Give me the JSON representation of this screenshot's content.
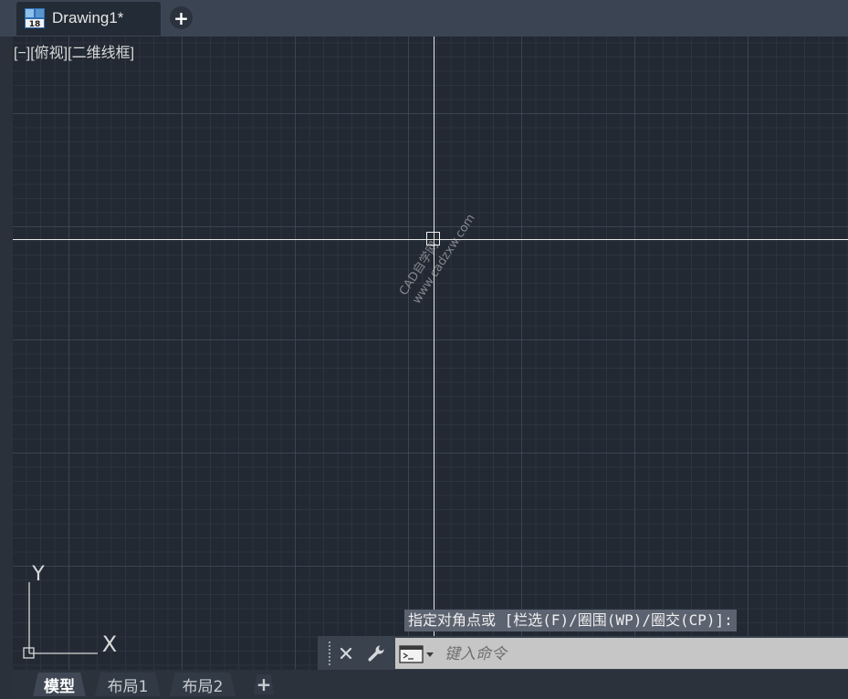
{
  "document_tab": {
    "title": "Drawing1*",
    "icon": "autocad-18-icon"
  },
  "new_tab": {
    "label": "+"
  },
  "viewport": {
    "view_label": "[−][俯视][二维线框]"
  },
  "watermark": {
    "line1": "CAD自学网",
    "line2": "www.cadzxw.com"
  },
  "ucs": {
    "y_label": "Y",
    "x_label": "X"
  },
  "command": {
    "prompt": "指定对角点或 [栏选(F)/圈围(WP)/圈交(CP)]:",
    "placeholder": "键入命令",
    "value": ""
  },
  "layout_tabs": [
    {
      "label": "模型",
      "active": true
    },
    {
      "label": "布局1",
      "active": false
    },
    {
      "label": "布局2",
      "active": false
    }
  ],
  "layout_add": {
    "label": "+"
  },
  "colors": {
    "canvas": "#222933",
    "tabstrip": "#3b4452",
    "crosshair": "#e8e8e8",
    "command_input": "#c6c6c6"
  }
}
